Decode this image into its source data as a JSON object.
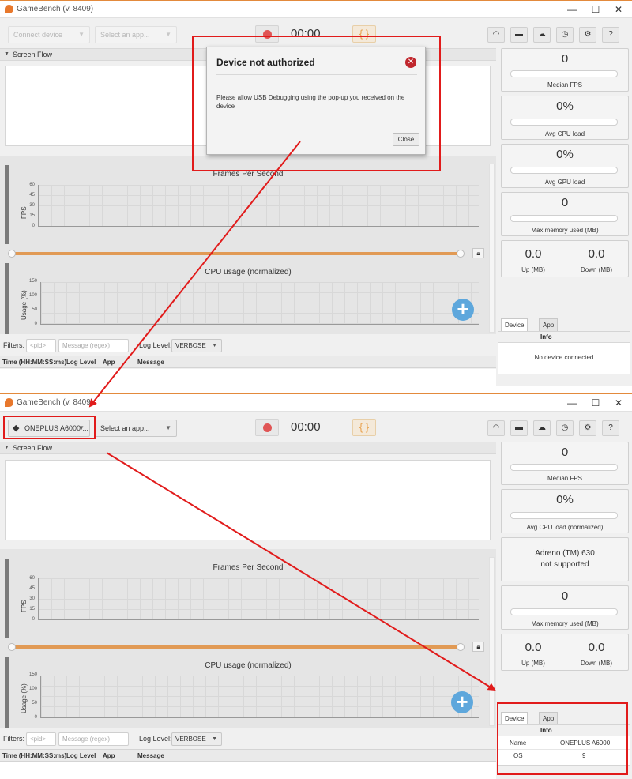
{
  "app": {
    "title": "GameBench (v. 8409)",
    "window_controls": {
      "minimize": "—",
      "maximize": "☐",
      "close": "✕"
    }
  },
  "top_window": {
    "toolbar": {
      "device_combo": "Connect device",
      "app_combo": "Select an app...",
      "timer": "00:00",
      "braces": "{ }"
    },
    "screen_flow_label": "Screen Flow",
    "fps_chart": {
      "title": "Frames Per Second",
      "ylabel": "FPS",
      "ticks": [
        "60",
        "45",
        "30",
        "15",
        "0"
      ]
    },
    "cpu_chart": {
      "title": "CPU usage (normalized)",
      "ylabel": "Usage (%)",
      "ticks": [
        "150",
        "100",
        "50",
        "0"
      ]
    },
    "filters": {
      "label": "Filters:",
      "pid_placeholder": "<pid>",
      "message_placeholder": "Message (regex)",
      "log_level_label": "Log Level:",
      "log_level_value": "VERBOSE"
    },
    "log_columns": [
      "Time (HH:MM:SS:ms)",
      "Log Level",
      "App",
      "Message"
    ],
    "stats": {
      "median_fps": {
        "value": "0",
        "label": "Median FPS"
      },
      "avg_cpu": {
        "value": "0%",
        "label": "Avg CPU load"
      },
      "avg_gpu": {
        "value": "0%",
        "label": "Avg GPU load"
      },
      "max_memory": {
        "value": "0",
        "label": "Max memory used (MB)"
      },
      "network": {
        "up_value": "0.0",
        "down_value": "0.0",
        "up_label": "Up (MB)",
        "down_label": "Down (MB)"
      }
    },
    "tabs": [
      "Device info",
      "App info"
    ],
    "info_header": "Info",
    "info_empty": "No device connected",
    "dialog": {
      "title": "Device not authorized",
      "message": "Please allow USB Debugging using the pop-up you received on the device",
      "close_button": "Close"
    }
  },
  "bottom_window": {
    "toolbar": {
      "device_combo": "ONEPLUS A6000 ...",
      "app_combo": "Select an app...",
      "timer": "00:00",
      "braces": "{ }"
    },
    "screen_flow_label": "Screen Flow",
    "fps_chart": {
      "title": "Frames Per Second",
      "ylabel": "FPS",
      "ticks": [
        "60",
        "45",
        "30",
        "15",
        "0"
      ]
    },
    "cpu_chart": {
      "title": "CPU usage (normalized)",
      "ylabel": "Usage (%)",
      "ticks": [
        "150",
        "100",
        "50",
        "0"
      ]
    },
    "filters": {
      "label": "Filters:",
      "pid_placeholder": "<pid>",
      "message_placeholder": "Message (regex)",
      "log_level_label": "Log Level:",
      "log_level_value": "VERBOSE"
    },
    "log_columns": [
      "Time (HH:MM:SS:ms)",
      "Log Level",
      "App",
      "Message"
    ],
    "stats": {
      "median_fps": {
        "value": "0",
        "label": "Median FPS"
      },
      "avg_cpu": {
        "value": "0%",
        "label": "Avg CPU load (normalized)"
      },
      "gpu": {
        "line1": "Adreno (TM) 630",
        "line2": "not supported"
      },
      "max_memory": {
        "value": "0",
        "label": "Max memory used (MB)"
      },
      "network": {
        "up_value": "0.0",
        "down_value": "0.0",
        "up_label": "Up (MB)",
        "down_label": "Down (MB)"
      }
    },
    "tabs": [
      "Device info",
      "App info"
    ],
    "info_header": "Info",
    "info_rows": [
      {
        "key": "Name",
        "value": "ONEPLUS A6000"
      },
      {
        "key": "OS",
        "value": "9"
      }
    ]
  },
  "colors": {
    "annotation": "#e11b1b",
    "accent_orange": "#e8782c",
    "record_red": "#e05555",
    "plus_blue": "#5ea7dc"
  },
  "icons": [
    "wifi-icon",
    "trash-icon",
    "cloud-upload-icon",
    "clock-icon",
    "settings-icon",
    "help-icon",
    "android-icon",
    "lock-icon",
    "plus-icon",
    "close-circle-icon"
  ]
}
